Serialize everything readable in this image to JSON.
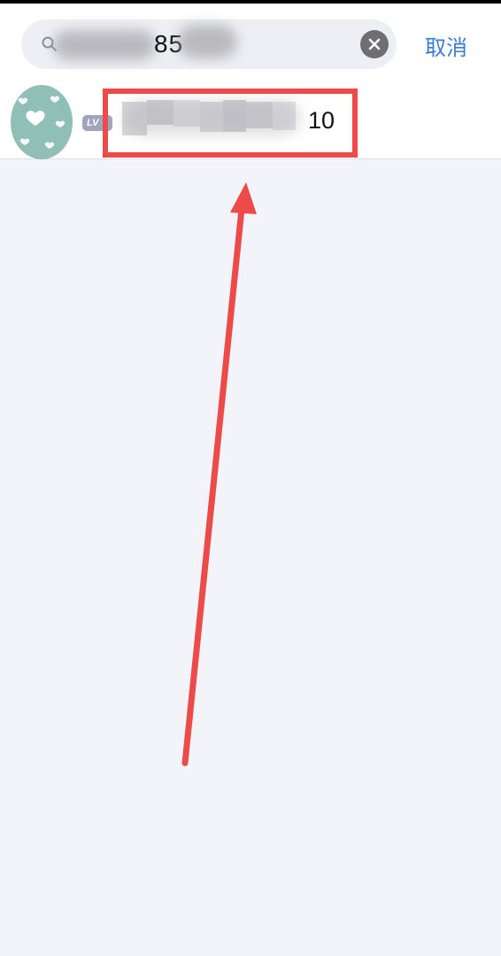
{
  "search": {
    "query_visible": "85",
    "placeholder": ""
  },
  "header": {
    "cancel_label": "取消"
  },
  "result": {
    "badge_label": "LV",
    "name_visible": "10"
  },
  "icons": {
    "search": "search-icon",
    "clear": "clear-icon",
    "avatar": "avatar-heart-pattern",
    "arrow": "arrow-up-icon"
  },
  "colors": {
    "accent": "#3a7bd5",
    "highlight": "#ed4a4a",
    "background": "#f3f4f9",
    "avatar": "#8fbfb6"
  }
}
